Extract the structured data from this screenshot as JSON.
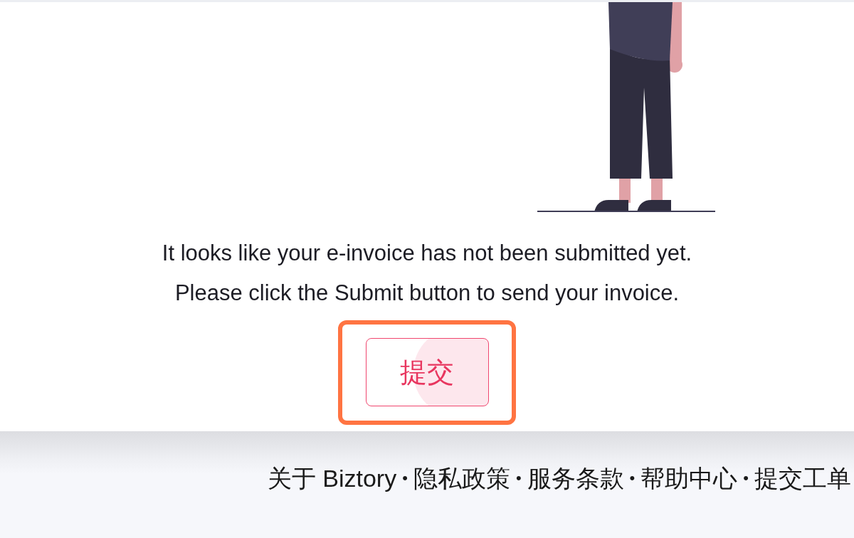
{
  "illustration": {
    "kind": "person"
  },
  "message": {
    "lines": [
      "It looks like your e-invoice has not been submitted yet.",
      "Please click the Submit button to send your invoice."
    ]
  },
  "submit_button": {
    "label": "提交",
    "highlighted": true
  },
  "footer": {
    "links": [
      {
        "label": "关于 Biztory",
        "separator": "•"
      },
      {
        "label": "隐私政策",
        "separator": "•"
      },
      {
        "label": "服务条款",
        "separator": "•"
      },
      {
        "label": "帮助中心",
        "separator": "•"
      },
      {
        "label": "提交工单"
      }
    ]
  }
}
